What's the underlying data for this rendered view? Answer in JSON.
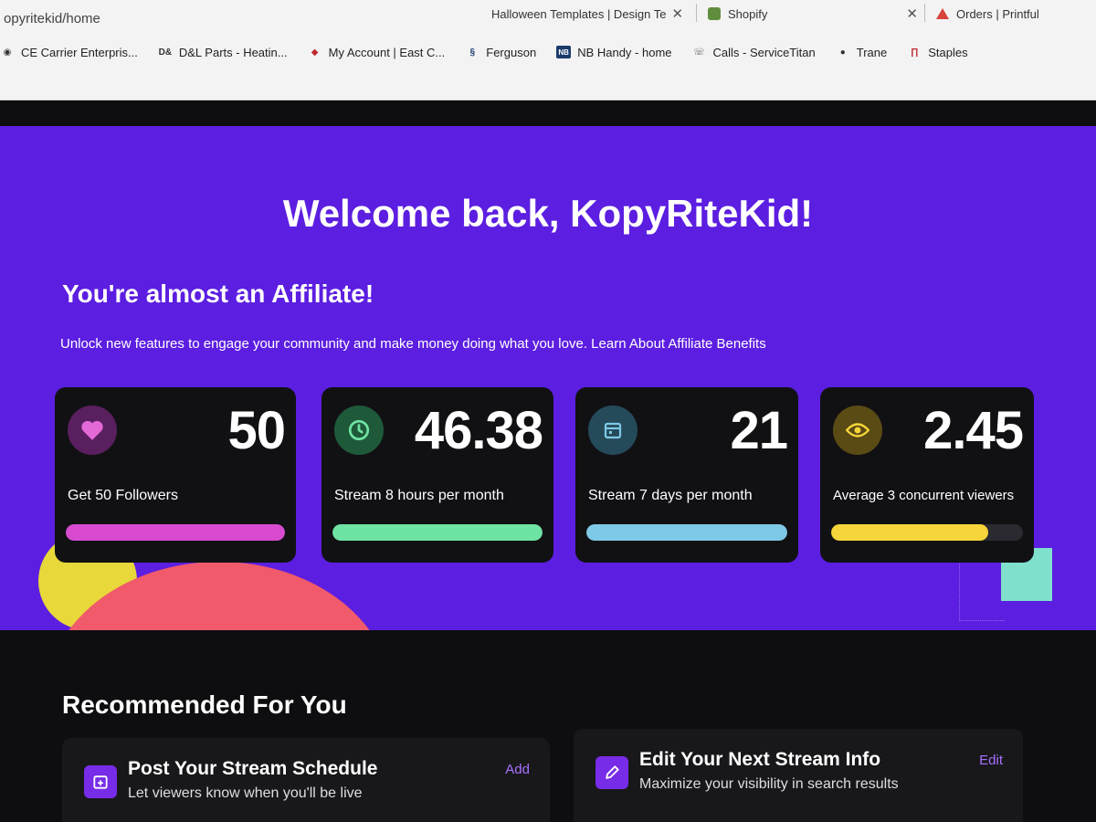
{
  "browser": {
    "url": "opyritekid/home",
    "tabs": [
      {
        "label": "Halloween Templates | Design Te"
      },
      {
        "label": "Shopify"
      },
      {
        "label": "Orders | Printful"
      }
    ],
    "bookmarks": [
      {
        "label": "CE Carrier Enterpris...",
        "icon": "ce-icon"
      },
      {
        "label": "D&L Parts - Heatin...",
        "icon": "dl-icon"
      },
      {
        "label": "My Account | East C...",
        "icon": "eastcoast-icon"
      },
      {
        "label": "Ferguson",
        "icon": "ferguson-icon"
      },
      {
        "label": "NB Handy - home",
        "icon": "nb-icon"
      },
      {
        "label": "Calls - ServiceTitan",
        "icon": "servicetitan-icon"
      },
      {
        "label": "Trane",
        "icon": "globe-icon"
      },
      {
        "label": "Staples",
        "icon": "staples-icon"
      }
    ]
  },
  "hero": {
    "welcome": "Welcome back, KopyRiteKid!",
    "almost": "You're almost an Affiliate!",
    "unlock_text": "Unlock new features to engage your community and make money doing what you love.",
    "learn_link": "Learn About Affiliate Benefits"
  },
  "cards": [
    {
      "value": "50",
      "label": "Get 50 Followers",
      "icon": "heart-icon",
      "progress": 1.0,
      "color": "#d84bd1",
      "icon_bg": "#5a1f5e",
      "icon_color": "#e368d8"
    },
    {
      "value": "46.38",
      "label": "Stream 8 hours per month",
      "icon": "clock-icon",
      "progress": 1.0,
      "color": "#6fe3a3",
      "icon_bg": "#1e5a3a",
      "icon_color": "#6fe3a3"
    },
    {
      "value": "21",
      "label": "Stream 7 days per month",
      "icon": "calendar-icon",
      "progress": 1.0,
      "color": "#7ec9e6",
      "icon_bg": "#254a5a",
      "icon_color": "#7ec9e6"
    },
    {
      "value": "2.45",
      "label": "Average 3 concurrent viewers",
      "icon": "eye-icon",
      "progress": 0.82,
      "color": "#f5d53a",
      "icon_bg": "#5a4a14",
      "icon_color": "#f5d53a"
    }
  ],
  "recommended": {
    "title": "Recommended For You",
    "items": [
      {
        "heading": "Post Your Stream Schedule",
        "sub": "Let viewers know when you'll be live",
        "action": "Add",
        "icon": "calendar-plus-icon"
      },
      {
        "heading": "Edit Your Next Stream Info",
        "sub": "Maximize your visibility in search results",
        "action": "Edit",
        "icon": "pencil-icon"
      }
    ]
  }
}
